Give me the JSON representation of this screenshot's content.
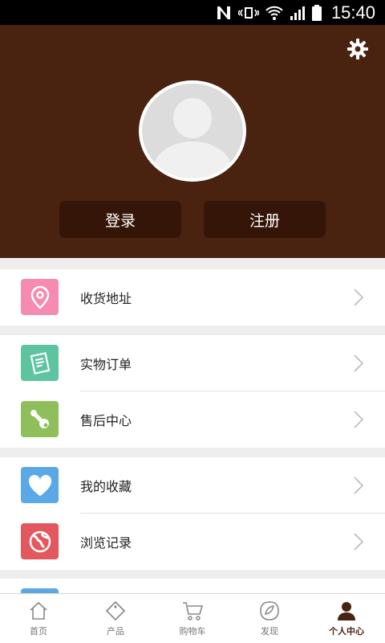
{
  "status_bar": {
    "time": "15:40"
  },
  "header": {
    "login_label": "登录",
    "register_label": "注册"
  },
  "menu": {
    "address": {
      "label": "收货地址",
      "icon": "location-pin-icon",
      "color": "#f58bb0"
    },
    "orders": {
      "label": "实物订单",
      "icon": "order-list-icon",
      "color": "#5ec4a0"
    },
    "after_sales": {
      "label": "售后中心",
      "icon": "wrench-icon",
      "color": "#8fbf5a"
    },
    "favorites": {
      "label": "我的收藏",
      "icon": "heart-icon",
      "color": "#5aa9e6"
    },
    "history": {
      "label": "浏览记录",
      "icon": "globe-icon",
      "color": "#e2585e"
    }
  },
  "tabs": [
    {
      "label": "首页",
      "icon": "home-icon"
    },
    {
      "label": "产品",
      "icon": "tag-icon"
    },
    {
      "label": "购物车",
      "icon": "cart-icon"
    },
    {
      "label": "发现",
      "icon": "discover-icon"
    },
    {
      "label": "个人中心",
      "icon": "person-icon",
      "active": true
    }
  ],
  "colors": {
    "header_bg": "#4a2210",
    "button_bg": "#341508"
  }
}
